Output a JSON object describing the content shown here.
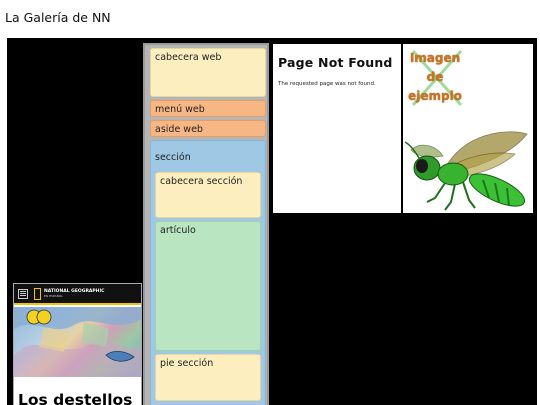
{
  "page": {
    "heading": "La Galería de NN"
  },
  "natgeo_card": {
    "brand": "NATIONAL GEOGRAPHIC",
    "edition": "EN ESPAÑOL",
    "title": "Los destellos"
  },
  "structure": {
    "cabecera_web": "cabecera web",
    "menu_web": "menú web",
    "aside_web": "aside web",
    "seccion": "sección",
    "cabecera_seccion": "cabecera sección",
    "articulo": "artículo",
    "pie_seccion": "pie sección"
  },
  "not_found": {
    "title": "Page Not Found",
    "message": "The requested page was not found."
  },
  "sample_image": {
    "line1": "Imagen",
    "line2": "de",
    "line3": "ejemplo"
  },
  "colors": {
    "gallery_bg": "#000000",
    "header_block": "#fdeebf",
    "nav_block": "#f6b785",
    "section_block": "#9ec8e4",
    "article_block": "#b9e5c1"
  },
  "icons": [
    "hamburger-menu-icon",
    "natgeo-logo-icon",
    "wasp-illustration"
  ]
}
